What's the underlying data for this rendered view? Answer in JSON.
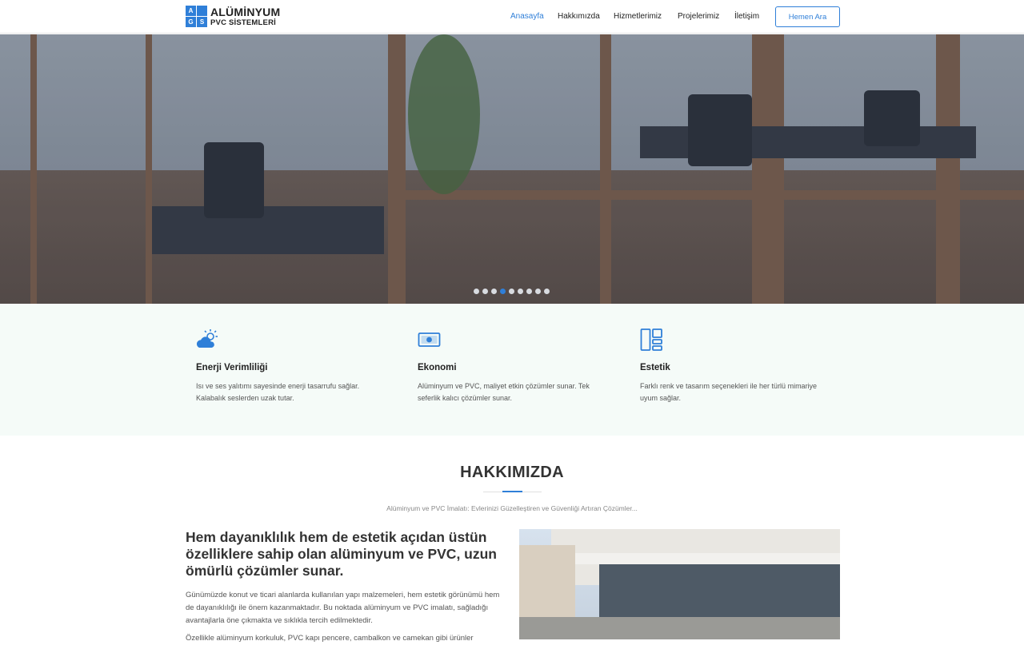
{
  "brand": {
    "grid": [
      "A",
      "",
      "G",
      "S"
    ],
    "line1": "ALÜMİNYUM",
    "line2": "PVC SİSTEMLERİ",
    "accent": "#2f7fd8"
  },
  "nav": {
    "items": [
      "Anasayfa",
      "Hakkımızda",
      "Hizmetlerimiz",
      "Projelerimiz",
      "İletişim"
    ],
    "active": "Anasayfa",
    "cta": "Hemen Ara"
  },
  "slider": {
    "slide_count": 9,
    "active_index": 3
  },
  "features": [
    {
      "icon": "sun-cloud-icon",
      "title": "Enerji Verimliliği",
      "text": "Isı ve ses yalıtımı sayesinde enerji tasarrufu sağlar. Kalabalık seslerden uzak tutar."
    },
    {
      "icon": "money-icon",
      "title": "Ekonomi",
      "text": "Alüminyum ve PVC, maliyet etkin çözümler sunar. Tek seferlik kalıcı çözümler sunar."
    },
    {
      "icon": "layout-icon",
      "title": "Estetik",
      "text": "Farklı renk ve tasarım seçenekleri ile her türlü mimariye uyum sağlar."
    }
  ],
  "about": {
    "title": "HAKKIMIZDA",
    "subtitle": "Alüminyum ve PVC İmalatı: Evlerinizi Güzelleştiren ve Güvenliği Artıran Çözümler...",
    "heading": "Hem dayanıklılık hem de estetik açıdan üstün özelliklere sahip olan alüminyum ve PVC, uzun ömürlü çözümler sunar.",
    "paragraph1": "Günümüzde konut ve ticari alanlarda kullanılan yapı malzemeleri, hem estetik görünümü hem de dayanıklılığı ile önem kazanmaktadır. Bu noktada alüminyum ve PVC imalatı, sağladığı avantajlarla öne çıkmakta ve sıklıkla tercih edilmektedir.",
    "paragraph2": "Özellikle alüminyum korkuluk, PVC kapı pencere, cambalkon ve camekan gibi ürünler"
  }
}
